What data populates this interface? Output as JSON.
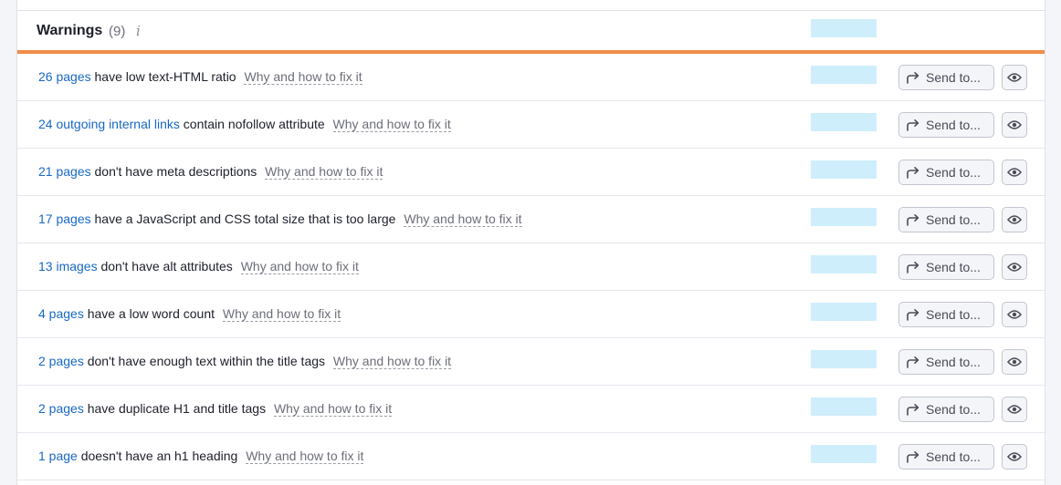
{
  "section": {
    "title": "Warnings",
    "count": "(9)",
    "info_icon": "info-icon"
  },
  "colors": {
    "accent_orange": "#f08d47",
    "link_blue": "#1868c4",
    "bar_blue": "#cfeefb"
  },
  "rows": [
    {
      "link": "26 pages",
      "text": "have low text-HTML ratio",
      "fix": "Why and how to fix it",
      "send": "Send to..."
    },
    {
      "link": "24 outgoing internal links",
      "text": "contain nofollow attribute",
      "fix": "Why and how to fix it",
      "send": "Send to..."
    },
    {
      "link": "21 pages",
      "text": "don't have meta descriptions",
      "fix": "Why and how to fix it",
      "send": "Send to..."
    },
    {
      "link": "17 pages",
      "text": "have a JavaScript and CSS total size that is too large",
      "fix": "Why and how to fix it",
      "send": "Send to..."
    },
    {
      "link": "13 images",
      "text": "don't have alt attributes",
      "fix": "Why and how to fix it",
      "send": "Send to..."
    },
    {
      "link": "4 pages",
      "text": "have a low word count",
      "fix": "Why and how to fix it",
      "send": "Send to..."
    },
    {
      "link": "2 pages",
      "text": "don't have enough text within the title tags",
      "fix": "Why and how to fix it",
      "send": "Send to..."
    },
    {
      "link": "2 pages",
      "text": "have duplicate H1 and title tags",
      "fix": "Why and how to fix it",
      "send": "Send to..."
    },
    {
      "link": "1 page",
      "text": "doesn't have an h1 heading",
      "fix": "Why and how to fix it",
      "send": "Send to..."
    }
  ]
}
